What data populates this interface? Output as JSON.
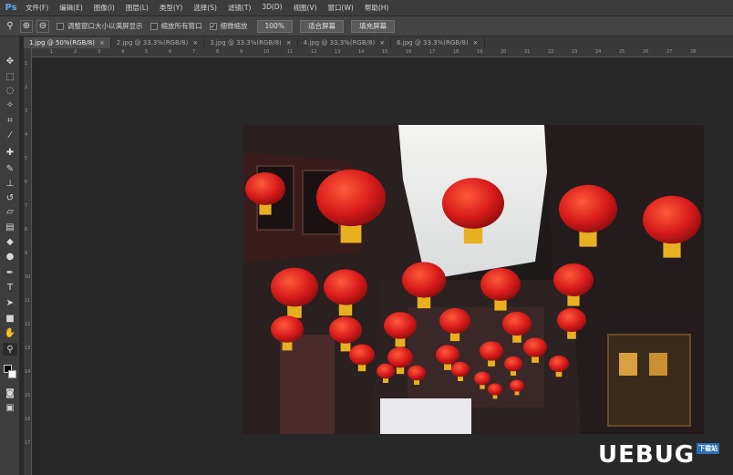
{
  "app": {
    "logo": "Ps"
  },
  "menubar": {
    "items": [
      "文件(F)",
      "编辑(E)",
      "图像(I)",
      "图层(L)",
      "类型(Y)",
      "选择(S)",
      "滤镜(T)",
      "3D(D)",
      "视图(V)",
      "窗口(W)",
      "帮助(H)"
    ]
  },
  "options": {
    "zoom_in_icon": "zoom-in-icon",
    "zoom_out_icon": "zoom-out-icon",
    "check_resize": {
      "label": "调整窗口大小以满屏显示",
      "checked": false
    },
    "check_zoom_all": {
      "label": "缩放所有窗口",
      "checked": false
    },
    "check_scrubby": {
      "label": "细微缩放",
      "checked": true
    },
    "btn_100": "100%",
    "btn_fit": "适合屏幕",
    "btn_fill": "填充屏幕"
  },
  "tabs": [
    {
      "label": "1.jpg @ 50%(RGB/8)",
      "close": "×"
    },
    {
      "label": "2.jpg @ 33.3%(RGB/8)",
      "close": "×"
    },
    {
      "label": "3.jpg @ 33.3%(RGB/8)",
      "close": "×"
    },
    {
      "label": "4.jpg @ 33.3%(RGB/8)",
      "close": "×"
    },
    {
      "label": "6.jpg @ 33.3%(RGB/8)",
      "close": "×"
    }
  ],
  "tools": [
    "move-icon",
    "marquee-icon",
    "lasso-icon",
    "magic-wand-icon",
    "crop-icon",
    "eyedropper-icon",
    "healing-icon",
    "brush-icon",
    "stamp-icon",
    "history-brush-icon",
    "eraser-icon",
    "gradient-icon",
    "blur-icon",
    "dodge-icon",
    "pen-icon",
    "type-icon",
    "path-select-icon",
    "shape-icon",
    "hand-icon",
    "zoom-icon",
    "color-swatch-icon",
    "quick-mask-icon",
    "screen-mode-icon"
  ],
  "ruler": {
    "ticks": [
      "1",
      "2",
      "3",
      "4",
      "5",
      "6",
      "7",
      "8",
      "9",
      "10",
      "11",
      "12",
      "13",
      "14",
      "15",
      "16",
      "17",
      "18",
      "19",
      "20",
      "21",
      "22",
      "23",
      "24",
      "25",
      "26",
      "27",
      "28"
    ]
  },
  "watermark": {
    "text": "UEBUG",
    "mark": "下载站"
  },
  "colors": {
    "accent": "#5da9e9",
    "lantern": "#d81b1b",
    "tassel": "#e8b020"
  }
}
